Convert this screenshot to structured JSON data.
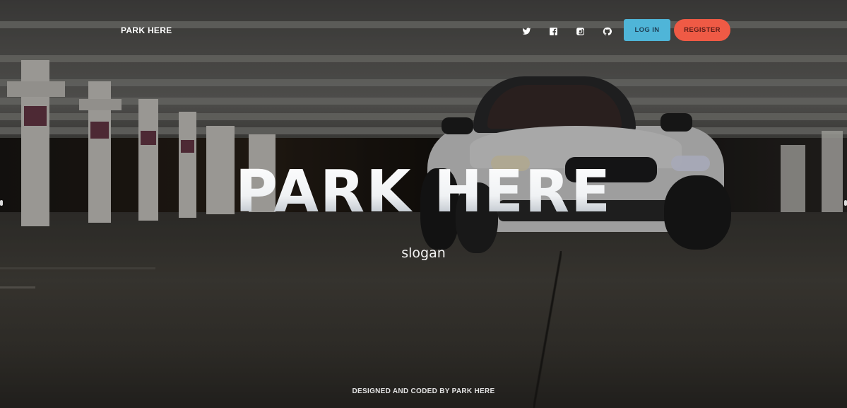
{
  "nav": {
    "brand": "PARK HERE",
    "social": [
      {
        "icon": "twitter-icon"
      },
      {
        "icon": "facebook-icon"
      },
      {
        "icon": "instagram-icon"
      },
      {
        "icon": "github-icon"
      }
    ],
    "login_label": "LOG IN",
    "register_label": "REGISTER"
  },
  "hero": {
    "title": "PARK HERE",
    "slogan": "slogan",
    "background": "parking-garage-car-photo"
  },
  "footer": {
    "credit": "DESIGNED AND CODED BY PARK HERE"
  },
  "colors": {
    "login_button": "#4fb5d8",
    "register_button": "#ef5a45",
    "text": "#ffffff"
  }
}
